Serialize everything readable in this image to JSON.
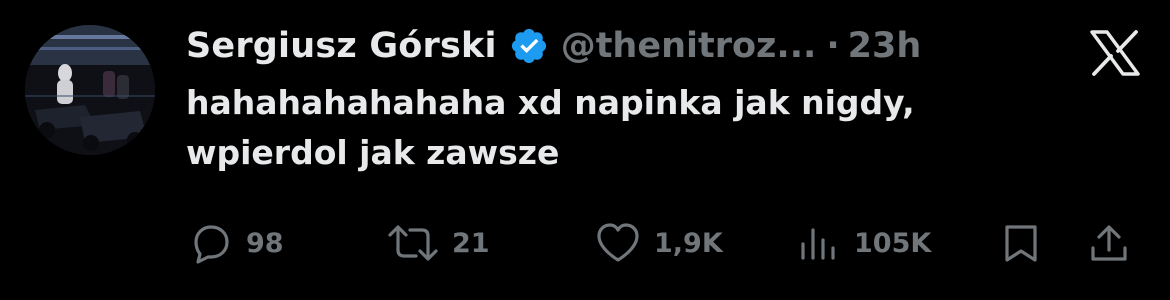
{
  "tweet": {
    "author": {
      "name": "Sergiusz Górski",
      "handle": "@thenitroz...",
      "verified": true,
      "avatar_icon": "avatar-karting-photo"
    },
    "separator": "·",
    "timestamp": "23h",
    "platform_icon": "x-logo-icon",
    "text_lines": [
      "hahahahahahaha xd napinka jak nigdy,",
      "wpierdol jak zawsze"
    ],
    "actions": {
      "reply": {
        "icon": "reply-icon",
        "count": "98"
      },
      "repost": {
        "icon": "repost-icon",
        "count": "21"
      },
      "like": {
        "icon": "heart-icon",
        "count": "1,9K"
      },
      "views": {
        "icon": "views-icon",
        "count": "105K"
      },
      "bookmark": {
        "icon": "bookmark-icon"
      },
      "share": {
        "icon": "share-icon"
      }
    }
  },
  "colors": {
    "background": "#000000",
    "primary_text": "#e7e9ea",
    "secondary_text": "#71767b",
    "verified_badge": "#1d9bf0"
  }
}
